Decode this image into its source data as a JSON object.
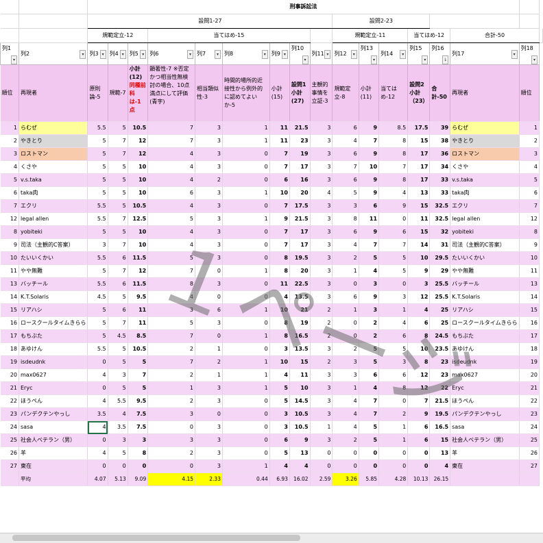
{
  "sheet": {
    "title": "刑事訴訟法",
    "q1_group": "設問1-27",
    "q2_group": "設問2-23",
    "subgroups": {
      "a": "規範定立-12",
      "b": "当てはめ-15",
      "c": "規範定立-11",
      "d": "当てはめ-12",
      "e": "合計-50"
    },
    "filter_labels": [
      "列1",
      "列2",
      "列3",
      "列4",
      "列5",
      "列6",
      "列7",
      "列8",
      "列9",
      "列10",
      "列11",
      "列12",
      "列13",
      "列14",
      "列15",
      "列16",
      "列17",
      "列18"
    ],
    "headers": {
      "rank": "順位",
      "name": "再現者",
      "c3": "原則論-5",
      "c4": "規範-7",
      "c5_a": "小計(12)",
      "c5_b": "同種前科は-1点",
      "c6": "顕著性-7 ※否定かつ相当性無検討の場合、10点満点にして評価(青字)",
      "c7": "相当類似性-3",
      "c8": "時間的場所的近接性から例外的に認めてよいか-5",
      "c9": "小計(15)",
      "c10": "設問1小計(27)",
      "c11": "主観的事情を立証-3",
      "c12": "規範定立-8",
      "c13": "小計(11)",
      "c14": "当てはめ-12",
      "c15": "設問2小計（23）",
      "c16": "合計-50",
      "c17": "再現者",
      "c18": "順位"
    },
    "sort_icon": "sort-down-arrow-icon",
    "rows": [
      {
        "rank": "1",
        "name": "らむぜ",
        "v": [
          "5.5",
          "5",
          "10.5",
          "7",
          "3",
          "1",
          "11",
          "21.5",
          "3",
          "6",
          "9",
          "8.5",
          "17.5",
          "39"
        ],
        "hl": "yellow"
      },
      {
        "rank": "2",
        "name": "やきとり",
        "v": [
          "5",
          "7",
          "12",
          "7",
          "3",
          "1",
          "11",
          "23",
          "3",
          "4",
          "7",
          "8",
          "15",
          "38"
        ],
        "hl": "gray"
      },
      {
        "rank": "3",
        "name": "ロストマン",
        "v": [
          "5",
          "7",
          "12",
          "4",
          "3",
          "0",
          "7",
          "19",
          "3",
          "6",
          "9",
          "8",
          "17",
          "36"
        ],
        "hl": "orange"
      },
      {
        "rank": "4",
        "name": "くさや",
        "v": [
          "5",
          "5",
          "10",
          "4",
          "3",
          "0",
          "7",
          "17",
          "3",
          "7",
          "10",
          "7",
          "17",
          "34"
        ],
        "hl": ""
      },
      {
        "rank": "5",
        "name": "v.s.taka",
        "v": [
          "5",
          "5",
          "10",
          "4",
          "2",
          "0",
          "6",
          "16",
          "3",
          "6",
          "9",
          "8",
          "17",
          "33"
        ],
        "hl": ""
      },
      {
        "rank": "6",
        "name": "taka肉",
        "v": [
          "5",
          "5",
          "10",
          "6",
          "3",
          "1",
          "10",
          "20",
          "4",
          "5",
          "9",
          "4",
          "13",
          "33"
        ],
        "hl": ""
      },
      {
        "rank": "7",
        "name": "エクリ",
        "v": [
          "5.5",
          "5",
          "10.5",
          "4",
          "3",
          "0",
          "7",
          "17.5",
          "3",
          "3",
          "6",
          "9",
          "15",
          "32.5"
        ],
        "hl": ""
      },
      {
        "rank": "12",
        "name": "legal allen",
        "v": [
          "5.5",
          "7",
          "12.5",
          "5",
          "3",
          "1",
          "9",
          "21.5",
          "3",
          "8",
          "11",
          "0",
          "11",
          "32.5"
        ],
        "hl": ""
      },
      {
        "rank": "8",
        "name": "yobiteki",
        "v": [
          "5",
          "5",
          "10",
          "4",
          "3",
          "0",
          "7",
          "17",
          "3",
          "6",
          "9",
          "6",
          "15",
          "32"
        ],
        "hl": ""
      },
      {
        "rank": "9",
        "name": "司法（主観的C答案）",
        "v": [
          "3",
          "7",
          "10",
          "4",
          "3",
          "0",
          "7",
          "17",
          "3",
          "4",
          "7",
          "7",
          "14",
          "31"
        ],
        "hl": ""
      },
      {
        "rank": "10",
        "name": "たいいくかい",
        "v": [
          "5.5",
          "6",
          "11.5",
          "5",
          "3",
          "0",
          "8",
          "19.5",
          "3",
          "2",
          "5",
          "5",
          "10",
          "29.5"
        ],
        "hl": ""
      },
      {
        "rank": "11",
        "name": "やや無難",
        "v": [
          "5",
          "7",
          "12",
          "7",
          "0",
          "1",
          "8",
          "20",
          "3",
          "1",
          "4",
          "5",
          "9",
          "29"
        ],
        "hl": ""
      },
      {
        "rank": "13",
        "name": "バッチール",
        "v": [
          "5.5",
          "6",
          "11.5",
          "8",
          "3",
          "0",
          "11",
          "22.5",
          "3",
          "0",
          "3",
          "0",
          "3",
          "25.5"
        ],
        "hl": ""
      },
      {
        "rank": "14",
        "name": "K.T.Solaris",
        "v": [
          "4.5",
          "5",
          "9.5",
          "4",
          "0",
          "0",
          "4",
          "13.5",
          "3",
          "6",
          "9",
          "3",
          "12",
          "25.5"
        ],
        "hl": ""
      },
      {
        "rank": "15",
        "name": "リアハシ",
        "v": [
          "5",
          "6",
          "11",
          "3",
          "6",
          "1",
          "10",
          "21",
          "2",
          "1",
          "3",
          "1",
          "4",
          "25"
        ],
        "hl": ""
      },
      {
        "rank": "16",
        "name": "ロースクールタイムきらら",
        "v": [
          "5",
          "7",
          "11",
          "5",
          "3",
          "0",
          "8",
          "19",
          "2",
          "0",
          "2",
          "4",
          "6",
          "25"
        ],
        "hl": ""
      },
      {
        "rank": "17",
        "name": "もちぶた",
        "v": [
          "5",
          "4.5",
          "8.5",
          "7",
          "0",
          "1",
          "8",
          "16.5",
          "2",
          "0",
          "2",
          "6",
          "8",
          "24.5"
        ],
        "hl": ""
      },
      {
        "rank": "18",
        "name": "あゆけん",
        "v": [
          "5.5",
          "5",
          "10.5",
          "2",
          "1",
          "0",
          "3",
          "13.5",
          "3",
          "2",
          "5",
          "5",
          "10",
          "23.5"
        ],
        "hl": ""
      },
      {
        "rank": "19",
        "name": "isdeudnk",
        "v": [
          "0",
          "5",
          "5",
          "7",
          "2",
          "1",
          "10",
          "15",
          "2",
          "3",
          "5",
          "3",
          "8",
          "23"
        ],
        "hl": ""
      },
      {
        "rank": "20",
        "name": "max0627",
        "v": [
          "4",
          "3",
          "7",
          "2",
          "1",
          "1",
          "4",
          "11",
          "3",
          "3",
          "6",
          "6",
          "12",
          "23"
        ],
        "hl": ""
      },
      {
        "rank": "21",
        "name": "Eryc",
        "v": [
          "0",
          "5",
          "5",
          "1",
          "3",
          "1",
          "5",
          "10",
          "3",
          "1",
          "4",
          "8",
          "12",
          "22"
        ],
        "hl": ""
      },
      {
        "rank": "22",
        "name": "ほうぺん",
        "v": [
          "4",
          "5.5",
          "9.5",
          "2",
          "3",
          "0",
          "5",
          "14.5",
          "3",
          "4",
          "7",
          "0",
          "7",
          "21.5"
        ],
        "hl": ""
      },
      {
        "rank": "23",
        "name": "パンデクテンやっし",
        "v": [
          "3.5",
          "4",
          "7.5",
          "3",
          "0",
          "0",
          "3",
          "10.5",
          "3",
          "4",
          "7",
          "2",
          "9",
          "19.5"
        ],
        "hl": ""
      },
      {
        "rank": "24",
        "name": "sasa",
        "v": [
          "4",
          "3.5",
          "7.5",
          "0",
          "3",
          "0",
          "3",
          "10.5",
          "1",
          "4",
          "5",
          "1",
          "6",
          "16.5"
        ],
        "hl": ""
      },
      {
        "rank": "25",
        "name": "社会人ベテラン（男）",
        "v": [
          "0",
          "3",
          "3",
          "3",
          "3",
          "0",
          "6",
          "9",
          "3",
          "2",
          "5",
          "1",
          "6",
          "15"
        ],
        "hl": ""
      },
      {
        "rank": "26",
        "name": "羊",
        "v": [
          "4",
          "5",
          "8",
          "2",
          "3",
          "0",
          "5",
          "13",
          "0",
          "0",
          "0",
          "0",
          "0",
          "13"
        ],
        "hl": ""
      },
      {
        "rank": "27",
        "name": "東在",
        "v": [
          "0",
          "0",
          "0",
          "0",
          "3",
          "1",
          "4",
          "4",
          "0",
          "0",
          "0",
          "0",
          "0",
          "4"
        ],
        "hl": ""
      }
    ],
    "average": {
      "label": "平均",
      "v": [
        "4.07",
        "5.13",
        "9.09",
        "4.15",
        "2.33",
        "0.44",
        "6.93",
        "16.02",
        "2.59",
        "3.26",
        "5.85",
        "4.28",
        "10.13",
        "26.15"
      ]
    },
    "watermark": "１ページ",
    "colors": {
      "header_pink": "#f3c8f0",
      "row_pink": "#f6d6f6",
      "highlight_yellow": "#ffff00",
      "rank1_yellow": "#ffff99",
      "rank2_gray": "#d9d9d9",
      "rank3_orange": "#f8cbad"
    }
  }
}
